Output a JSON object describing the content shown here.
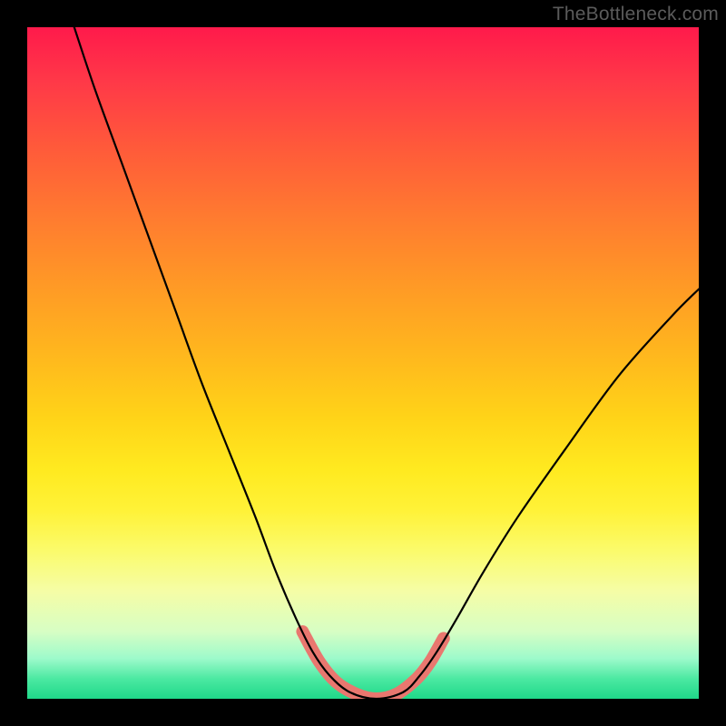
{
  "watermark": "TheBottleneck.com",
  "chart_data": {
    "type": "line",
    "title": "",
    "xlabel": "",
    "ylabel": "",
    "xlim": [
      0,
      100
    ],
    "ylim": [
      0,
      100
    ],
    "series": [
      {
        "name": "bottleneck-curve",
        "x": [
          7,
          10,
          14,
          18,
          22,
          26,
          30,
          34,
          37,
          40,
          42.5,
          45,
          48,
          52,
          56,
          58.5,
          61,
          64,
          68,
          73,
          80,
          88,
          96,
          100
        ],
        "y": [
          100,
          91,
          80,
          69,
          58,
          47,
          37,
          27,
          19,
          12,
          7,
          3.5,
          1,
          0,
          1,
          3.5,
          7,
          12,
          19,
          27,
          37,
          48,
          57,
          61
        ]
      }
    ],
    "markers": {
      "name": "highlight-points",
      "points": [
        {
          "x": 41,
          "y": 10
        },
        {
          "x": 43.5,
          "y": 5.5
        },
        {
          "x": 46,
          "y": 2.5
        },
        {
          "x": 49,
          "y": 0.7
        },
        {
          "x": 52,
          "y": 0
        },
        {
          "x": 55,
          "y": 0.7
        },
        {
          "x": 58,
          "y": 3
        },
        {
          "x": 60,
          "y": 5.5
        },
        {
          "x": 62,
          "y": 9
        }
      ]
    },
    "colors": {
      "curve": "#000000",
      "markers": "#e9776f",
      "gradient_top": "#ff1a4b",
      "gradient_bottom": "#1fd889"
    }
  }
}
